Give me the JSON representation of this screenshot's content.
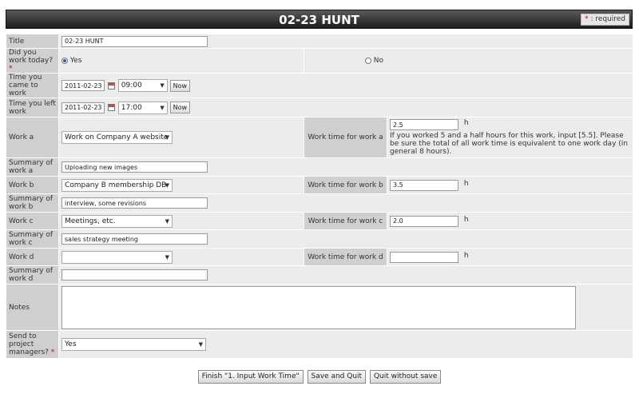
{
  "header": {
    "title": "02-23 HUNT",
    "required_star": "*",
    "required_text": ": required"
  },
  "form": {
    "title": {
      "label": "Title",
      "value": "02-23 HUNT"
    },
    "worked_today": {
      "label": "Did you work today?",
      "star": "*",
      "yes": "Yes",
      "no": "No",
      "selected": "Yes"
    },
    "time_came": {
      "label": "Time you came to work",
      "date": "2011-02-23",
      "time": "09:00",
      "now_label": "Now"
    },
    "time_left": {
      "label": "Time you left work",
      "date": "2011-02-23",
      "time": "17:00",
      "now_label": "Now"
    },
    "work_a": {
      "label": "Work a",
      "selected": "Work on Company A website",
      "time_label": "Work time for work a",
      "time_value": "2.5",
      "unit": "h",
      "hint": "If you worked 5 and a half hours for this work, input [5.5]. Please be sure the total of all work time is equivalent to one work day (in general 8 hours).",
      "summary_label": "Summary of work a",
      "summary_value": "Uploading new images"
    },
    "work_b": {
      "label": "Work b",
      "selected": "Company B membership DB",
      "time_label": "Work time for work b",
      "time_value": "3.5",
      "unit": "h",
      "summary_label": "Summary of work b",
      "summary_value": "interview, some revisions"
    },
    "work_c": {
      "label": "Work c",
      "selected": "Meetings, etc.",
      "time_label": "Work time for work c",
      "time_value": "2.0",
      "unit": "h",
      "summary_label": "Summary of work c",
      "summary_value": "sales strategy meeting"
    },
    "work_d": {
      "label": "Work d",
      "selected": "",
      "time_label": "Work time for work d",
      "time_value": "",
      "unit": "h",
      "summary_label": "Summary of work d",
      "summary_value": ""
    },
    "notes": {
      "label": "Notes",
      "value": ""
    },
    "send_pm": {
      "label": "Send to project managers?",
      "star": "*",
      "selected": "Yes"
    }
  },
  "footer": {
    "finish_label": "Finish \"1. Input Work Time\"",
    "save_quit_label": "Save and Quit",
    "quit_label": "Quit without save"
  }
}
